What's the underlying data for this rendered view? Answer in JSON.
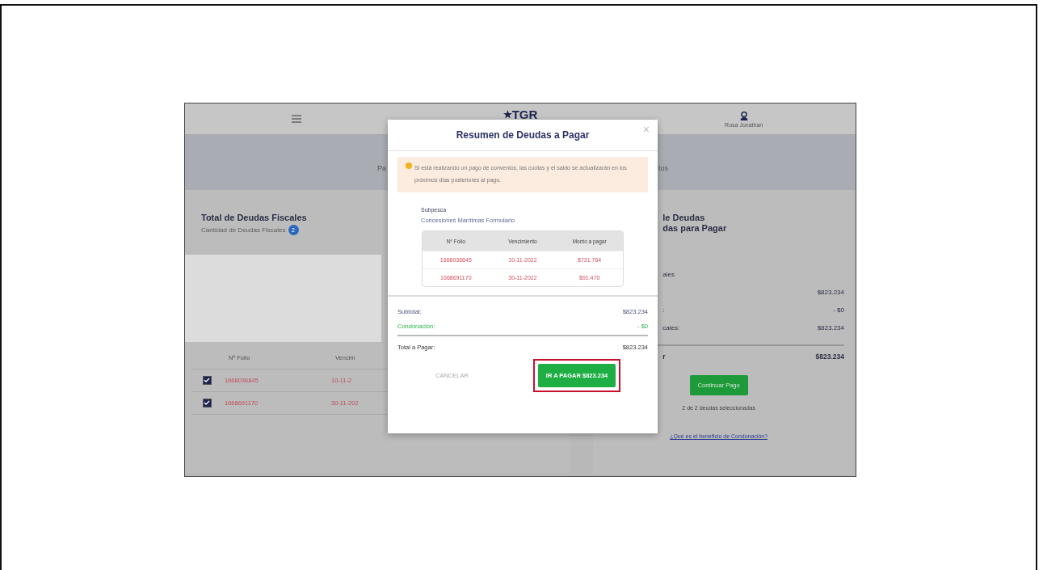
{
  "header": {
    "logo": "TGR",
    "user_name": "Rosa Jonathan"
  },
  "banner": {
    "left_text": "Pa",
    "right_text": "tos"
  },
  "debts_card": {
    "title": "Total de Deudas Fiscales",
    "subtitle": "Cantidad de Deudas Fiscales",
    "count": "2",
    "columns": [
      "Nº Folio",
      "Vencim"
    ],
    "rows": [
      {
        "folio": "1668036845",
        "date": "10-11-2",
        "checked": true
      },
      {
        "folio": "1668691170",
        "date": "30-11-202",
        "checked": true
      }
    ]
  },
  "summary_card": {
    "title_lines": [
      "le Deudas",
      "das para Pagar"
    ],
    "section": "ales",
    "lines": [
      {
        "value": "$823.234"
      },
      {
        "label": ":",
        "value": "- $0"
      },
      {
        "label": "cales:",
        "value": "$823.234"
      }
    ],
    "total": {
      "label": "r",
      "value": "$823.234"
    },
    "button": "Continuar Pago",
    "selection_note": "2 de 2 deudas seleccionadas",
    "link": "¿Qué es el beneficio de Condonación?"
  },
  "modal": {
    "title": "Resumen de Deudas a Pagar",
    "close": "×",
    "alert": "Si está realizando un pago de convenios, las cuotas y el saldo se actualizarán en los próximos días posteriores al pago.",
    "institution": "Subpesca",
    "concept": "Concesiones Marítimas Formulario",
    "columns": [
      "Nº Folio",
      "Vencimiento",
      "Monto a pagar"
    ],
    "rows": [
      {
        "folio": "1668036845",
        "date": "10-11-2022",
        "amount": "$731.764"
      },
      {
        "folio": "1668691170",
        "date": "30-11-2022",
        "amount": "$91.470"
      }
    ],
    "totals": [
      {
        "kind": "subtotal",
        "label": "Subtotal:",
        "value": "$823.234"
      },
      {
        "kind": "discount",
        "label": "Condonación:",
        "value": "- $0"
      },
      {
        "kind": "total",
        "label": "Total a Pagar:",
        "value": "$823.234"
      }
    ],
    "cancel": "CANCELAR",
    "pay": "IR A PAGAR $823.234",
    "pay_highlighted": true
  }
}
